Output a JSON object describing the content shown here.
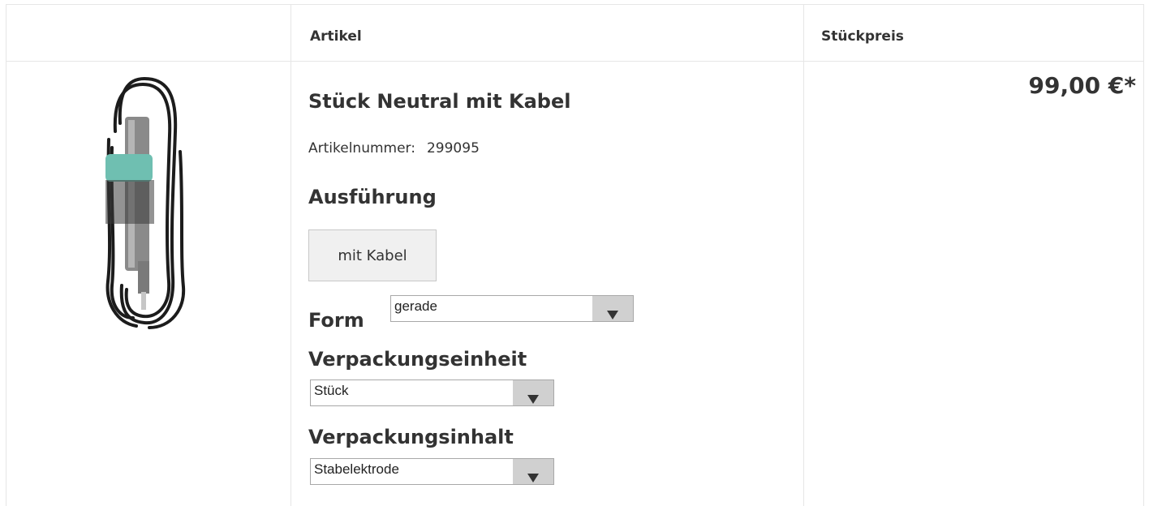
{
  "table": {
    "headers": {
      "article": "Artikel",
      "unit_price": "Stückpreis"
    }
  },
  "product": {
    "title": "Stück Neutral mit Kabel",
    "article_number_label": "Artikelnummer:",
    "article_number": "299095",
    "price": "99,00 €*",
    "image_icon": "cable-product-image"
  },
  "options": {
    "ausfuehrung": {
      "label": "Ausführung",
      "button": "mit Kabel"
    },
    "form": {
      "label": "Form",
      "selected": "gerade"
    },
    "verpackungseinheit": {
      "label": "Verpackungseinheit",
      "selected": "Stück"
    },
    "verpackungsinhalt": {
      "label": "Verpackungsinhalt",
      "selected": "Stabelektrode"
    }
  },
  "colors": {
    "border": "#e6e6e6",
    "text": "#333333",
    "cable_clip": "#6fbfb1"
  }
}
